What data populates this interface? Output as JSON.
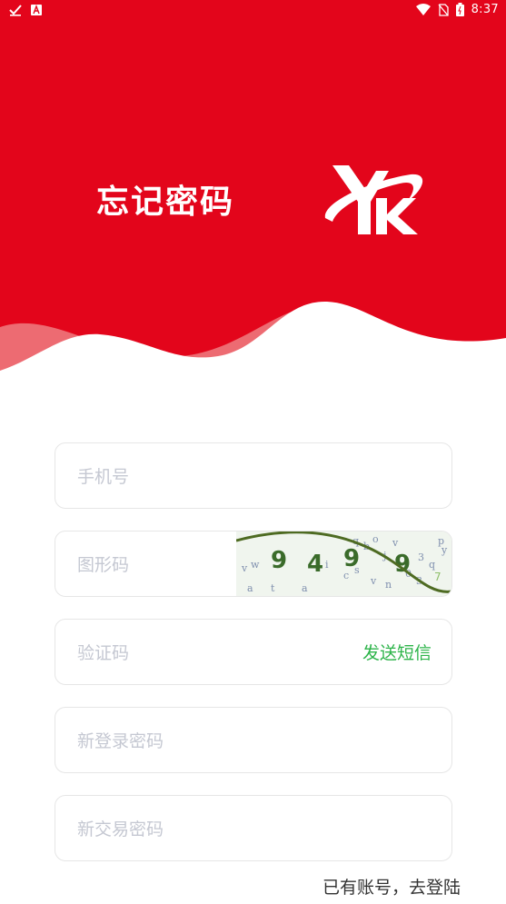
{
  "status_bar": {
    "time": "8:37",
    "icons": [
      "check-icon",
      "notification-a-icon",
      "wifi-icon",
      "no-sim-icon",
      "battery-icon"
    ]
  },
  "header": {
    "title": "忘记密码",
    "logo_text": "YK",
    "background_color": "#e3051b"
  },
  "form": {
    "phone": {
      "placeholder": "手机号",
      "value": ""
    },
    "captcha": {
      "placeholder": "图形码",
      "value": "",
      "image_text": "9 4 9 9"
    },
    "sms_code": {
      "placeholder": "验证码",
      "value": "",
      "send_label": "发送短信"
    },
    "new_login_password": {
      "placeholder": "新登录密码",
      "value": ""
    },
    "new_trade_password": {
      "placeholder": "新交易密码",
      "value": ""
    }
  },
  "footer": {
    "login_link": "已有账号，去登陆"
  },
  "colors": {
    "accent_red": "#e3051b",
    "sms_green": "#2db44a",
    "placeholder": "#c5c8d2",
    "border": "#e6e6e6"
  }
}
